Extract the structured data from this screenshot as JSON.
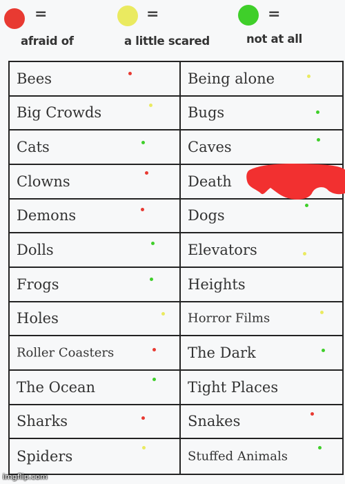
{
  "colors": {
    "afraid": "#e83a32",
    "little": "#eaea60",
    "none": "#3fcf2a",
    "scribble": "#f23030"
  },
  "legend": [
    {
      "key": "afraid",
      "symbol": "=",
      "label": "afraid of"
    },
    {
      "key": "little",
      "symbol": "=",
      "label": "a little scared"
    },
    {
      "key": "none",
      "symbol": "=",
      "label": "not at all"
    }
  ],
  "rows": [
    {
      "left": {
        "label": "Bees",
        "rating": "afraid"
      },
      "right": {
        "label": "Being alone",
        "rating": "little"
      }
    },
    {
      "left": {
        "label": "Big Crowds",
        "rating": "little"
      },
      "right": {
        "label": "Bugs",
        "rating": "none"
      }
    },
    {
      "left": {
        "label": "Cats",
        "rating": "none"
      },
      "right": {
        "label": "Caves",
        "rating": "none"
      }
    },
    {
      "left": {
        "label": "Clowns",
        "rating": "afraid"
      },
      "right": {
        "label": "Death",
        "rating": ""
      }
    },
    {
      "left": {
        "label": "Demons",
        "rating": "afraid"
      },
      "right": {
        "label": "Dogs",
        "rating": "none"
      }
    },
    {
      "left": {
        "label": "Dolls",
        "rating": "none"
      },
      "right": {
        "label": "Elevators",
        "rating": "little"
      }
    },
    {
      "left": {
        "label": "Frogs",
        "rating": "none"
      },
      "right": {
        "label": "Heights",
        "rating": ""
      }
    },
    {
      "left": {
        "label": "Holes",
        "rating": "little"
      },
      "right": {
        "label": "Horror Films",
        "rating": "little"
      }
    },
    {
      "left": {
        "label": "Roller Coasters",
        "rating": "afraid"
      },
      "right": {
        "label": "The Dark",
        "rating": "none"
      }
    },
    {
      "left": {
        "label": "The Ocean",
        "rating": "none"
      },
      "right": {
        "label": "Tight Places",
        "rating": ""
      }
    },
    {
      "left": {
        "label": "Sharks",
        "rating": "afraid"
      },
      "right": {
        "label": "Snakes",
        "rating": "afraid"
      }
    },
    {
      "left": {
        "label": "Spiders",
        "rating": "little"
      },
      "right": {
        "label": "Stuffed Animals",
        "rating": "none"
      }
    }
  ],
  "watermark": "imgflip.com"
}
